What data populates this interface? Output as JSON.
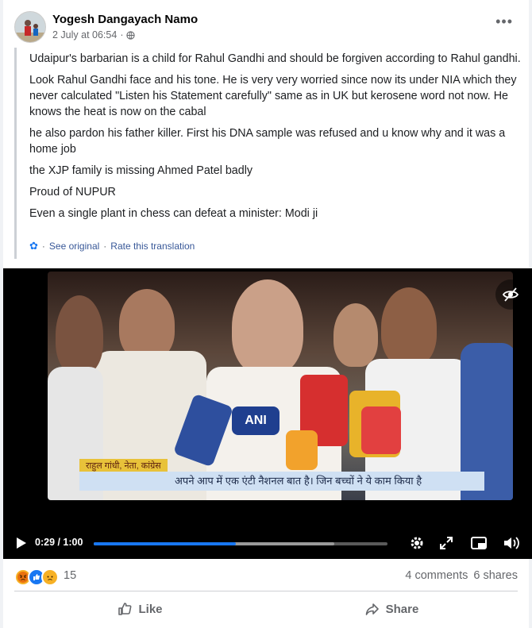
{
  "post": {
    "author": "Yogesh Dangayach Namo",
    "timestamp": "2 July at 06:54",
    "dot": "·",
    "audience_icon": "globe-icon",
    "more_label": "•••",
    "paragraphs": [
      "Udaipur's barbarian is a child for Rahul Gandhi and should be forgiven according to Rahul gandhi.",
      "Look Rahul Gandhi face and his tone. He is very very worried since now its under NIA which they never calculated \"Listen his Statement carefully\" same as in UK but kerosene word not now. He knows the heat is now on the cabal",
      "he also pardon his father killer. First his DNA sample was refused and u know why and it was a home job",
      "the XJP family is missing Ahmed Patel badly",
      "Proud of NUPUR",
      "Even a single plant in chess can defeat a minister: Modi ji"
    ],
    "see_original": "See original",
    "translation_sep": "·",
    "rate_translation": "Rate this translation"
  },
  "video": {
    "current_time": "0:29",
    "duration": "1:00",
    "time_display": "0:29 / 1:00",
    "progress": 0.483,
    "buffered": 0.82,
    "caption_text": "अपने आप में एक एंटी नैशनल बात है। जिन बच्चों ने ये काम किया है",
    "name_tag": "राहुल गांधी, नेता, कांग्रेस",
    "mic_label": "ANI"
  },
  "stats": {
    "reaction_count": "15",
    "reactions": [
      "angry",
      "like",
      "sad"
    ],
    "comments": "4 comments",
    "shares": "6 shares"
  },
  "actions": {
    "like": "Like",
    "share": "Share"
  },
  "colors": {
    "accent": "#1877f2",
    "link": "#385898",
    "secondary_text": "#65676b"
  }
}
